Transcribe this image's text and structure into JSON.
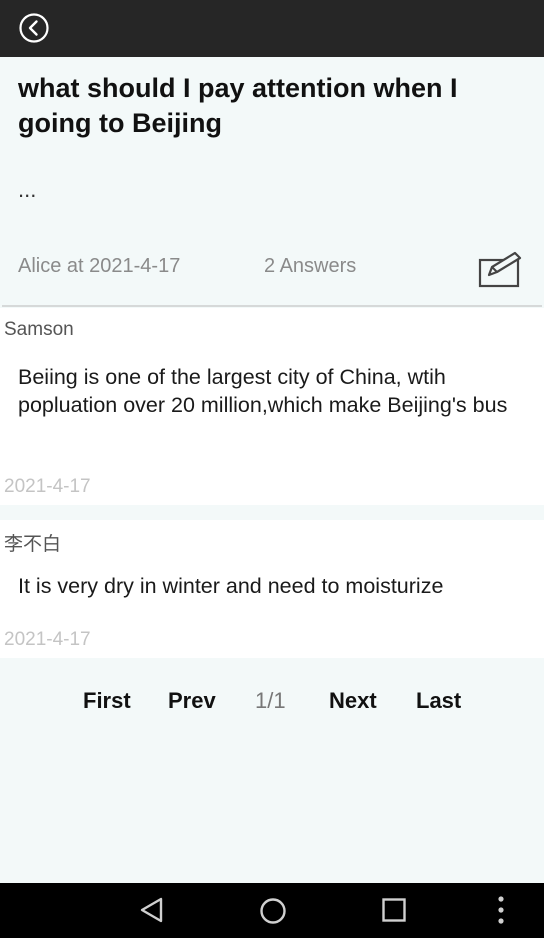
{
  "header": {
    "back_icon": "back-circle-arrow-icon"
  },
  "question": {
    "title": "what should I pay attention when I going to Beijing",
    "body": "...",
    "meta": "Alice at 2021-4-17",
    "answers_count": "2 Answers",
    "edit_icon": "edit-pencil-icon"
  },
  "answers": [
    {
      "user": "Samson",
      "text": "Beiing is one of the largest city of China, wtih popluation over 20 million,which make Beijing's bus",
      "date": "2021-4-17"
    },
    {
      "user": "李不白",
      "text": "It is very dry in winter and need to moisturize",
      "date": "2021-4-17"
    }
  ],
  "pager": {
    "first": "First",
    "prev": "Prev",
    "page": "1/1",
    "next": "Next",
    "last": "Last"
  },
  "navbar": {
    "back": "nav-back-icon",
    "home": "nav-home-icon",
    "recents": "nav-recents-icon",
    "menu": "nav-menu-icon"
  }
}
